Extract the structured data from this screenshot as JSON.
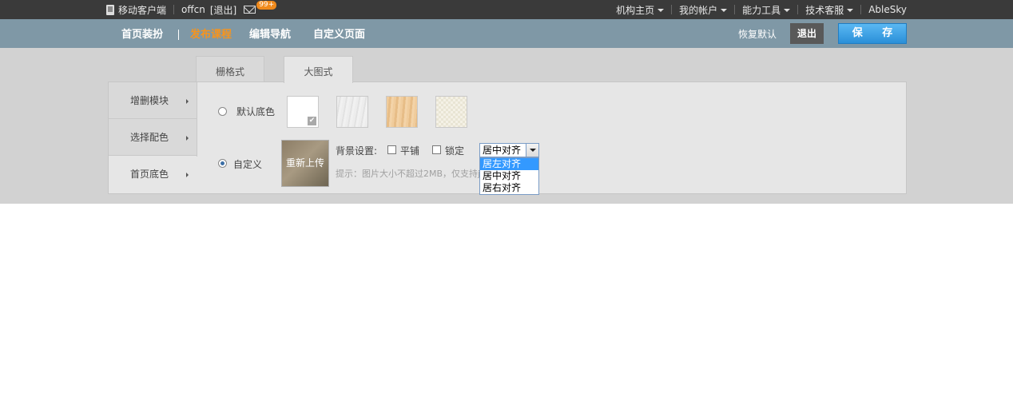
{
  "topbar": {
    "mobile_client": "移动客户端",
    "user": "offcn",
    "logout": "[退出]",
    "mail_badge": "99+",
    "menus": [
      "机构主页",
      "我的帐户",
      "能力工具",
      "技术客服"
    ],
    "brand": "AbleSky"
  },
  "nav": {
    "items": [
      "首页装扮",
      "发布课程",
      "编辑导航",
      "自定义页面"
    ],
    "active_index": 1,
    "restore_default": "恢复默认",
    "exit": "退出",
    "save": "保 存"
  },
  "tabs": [
    "栅格式",
    "大图式"
  ],
  "sidebar": {
    "items": [
      "增删模块",
      "选择配色",
      "首页底色"
    ],
    "active_index": 2
  },
  "background": {
    "default_label": "默认底色",
    "custom_label": "自定义",
    "selected_option": "custom",
    "reupload": "重新上传",
    "settings_label": "背景设置:",
    "tile_label": "平铺",
    "lock_label": "锁定",
    "align_value": "居中对齐",
    "align_options": [
      "居左对齐",
      "居中对齐",
      "居右对齐"
    ],
    "highlighted_option": "居左对齐",
    "hint": "提示：图片大小不超过2MB，仅支持jpg、gif、png"
  },
  "colors": {
    "topbar_bg": "#3a3a3a",
    "navbar_bg": "#7f98a6",
    "active_nav": "#f7941d",
    "save_button": "#2a8fd8"
  }
}
